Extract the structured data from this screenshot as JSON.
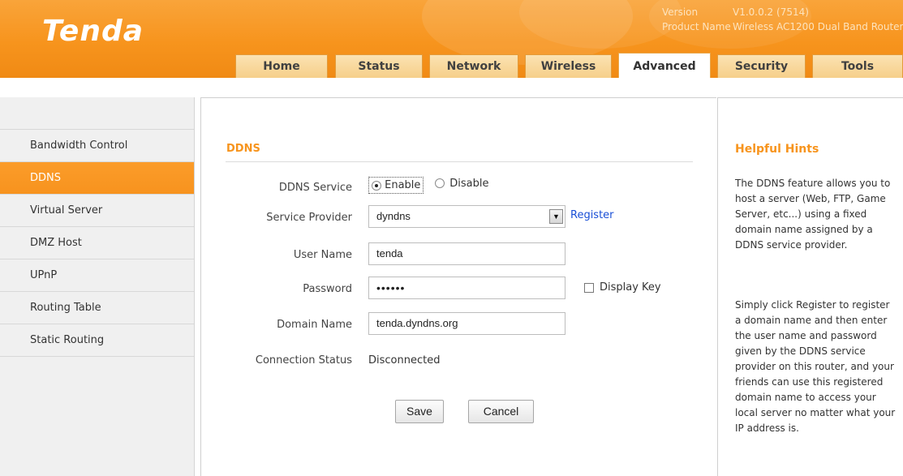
{
  "brand": {
    "logo_text": "Tenda",
    "accent": "#f7941d",
    "link": "#1a4fd6"
  },
  "header": {
    "version_label": "Version",
    "version_value": "V1.0.0.2 (7514)",
    "product_label": "Product Name",
    "product_value": "Wireless AC1200 Dual Band Router"
  },
  "nav": {
    "tabs": [
      {
        "label": "Home"
      },
      {
        "label": "Status"
      },
      {
        "label": "Network"
      },
      {
        "label": "Wireless"
      },
      {
        "label": "Advanced",
        "active": true
      },
      {
        "label": "Security"
      },
      {
        "label": "Tools"
      }
    ]
  },
  "sidebar": {
    "items": [
      {
        "label": "Bandwidth Control"
      },
      {
        "label": "DDNS",
        "active": true
      },
      {
        "label": "Virtual Server"
      },
      {
        "label": "DMZ Host"
      },
      {
        "label": "UPnP"
      },
      {
        "label": "Routing Table"
      },
      {
        "label": "Static Routing"
      }
    ]
  },
  "main": {
    "title": "DDNS",
    "service": {
      "label": "DDNS Service",
      "enable": "Enable",
      "disable": "Disable",
      "selected": "Enable"
    },
    "provider": {
      "label": "Service Provider",
      "value": "dyndns",
      "register_link": "Register"
    },
    "username": {
      "label": "User Name",
      "value": "tenda"
    },
    "password": {
      "label": "Password",
      "value": "••••••",
      "display_key": "Display Key",
      "display_key_checked": false
    },
    "domain": {
      "label": "Domain Name",
      "value": "tenda.dyndns.org"
    },
    "status": {
      "label": "Connection Status",
      "value": "Disconnected"
    },
    "buttons": {
      "save": "Save",
      "cancel": "Cancel"
    }
  },
  "hints": {
    "title": "Helpful Hints",
    "p1": "The DDNS feature allows you to host a server (Web, FTP, Game Server, etc...) using a fixed domain name assigned by a DDNS service provider.",
    "p2": "Simply click Register to register a domain name and then enter the user name and password given by the DDNS service provider on this router, and your friends can use this registered domain name to access your local server no matter what your IP address is."
  }
}
